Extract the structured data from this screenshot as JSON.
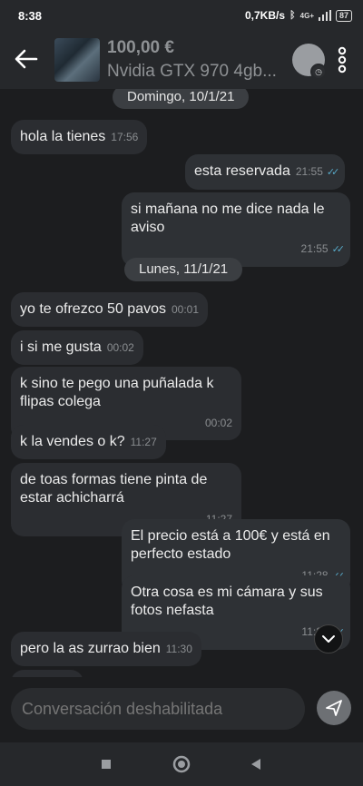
{
  "status_bar": {
    "time": "8:38",
    "speed": "0,7KB/s",
    "bluetooth_icon": "bluetooth-icon",
    "network": "4G+",
    "battery": "87"
  },
  "header": {
    "back_icon": "arrow-left-icon",
    "price": "100,00 €",
    "title": "Nvidia GTX 970 4gb...",
    "avatar_badge_icon": "clock-icon",
    "more_icon": "more-vertical-icon"
  },
  "chat": {
    "date1": "Domingo, 10/1/21",
    "date2": "Lunes, 11/1/21",
    "messages": [
      {
        "text": "hola la tienes",
        "time": "17:56"
      },
      {
        "text": "esta reservada",
        "time": "21:55"
      },
      {
        "text": "si mañana no me dice nada le aviso",
        "time": "21:55"
      },
      {
        "text": "yo te ofrezco 50 pavos",
        "time": "00:01"
      },
      {
        "text": "i si me gusta",
        "time": "00:02"
      },
      {
        "text": "k sino te pego una puñalada k flipas colega",
        "time": "00:02"
      },
      {
        "text": "k la vendes o k?",
        "time": "11:27"
      },
      {
        "text": "de toas formas tiene pinta de estar achicharrá",
        "time": "11:27"
      },
      {
        "text": "El precio está a 100€ y está en perfecto estado",
        "time": "11:28"
      },
      {
        "text": "Otra cosa es mi cámara y sus fotos nefasta",
        "time": "11:29"
      },
      {
        "text": "pero la as zurrao bien",
        "time": "11:30"
      }
    ],
    "read_icon": "double-check-icon",
    "scroll_icon": "chevron-down-icon"
  },
  "input": {
    "placeholder": "Conversación deshabilitada",
    "send_icon": "send-icon"
  },
  "nav": {
    "recents_icon": "square-icon",
    "home_icon": "circle-icon",
    "back_icon": "triangle-back-icon"
  },
  "colors": {
    "background": "#1c1d1f",
    "bubble_in": "#2b2d31",
    "bubble_out": "#2e3135",
    "read_check": "#57a8c7"
  }
}
